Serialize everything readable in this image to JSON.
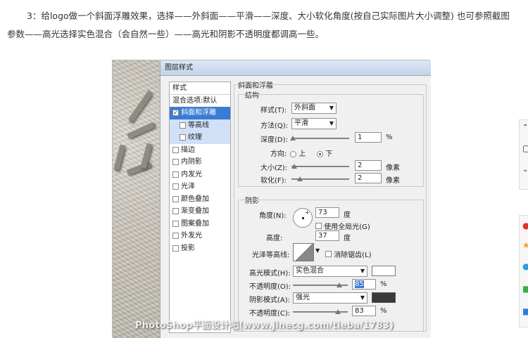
{
  "article": {
    "paragraph": "3：给logo做一个斜面浮雕效果，选择——外斜面——平滑——深度、大小软化角度(按自己实际图片大小调整) 也可参照截图参数——高光选择实色混合（会自然一些）——高光和阴影不透明度都调高一些。"
  },
  "dialog": {
    "title": "图层样式",
    "style_list": {
      "header": "样式",
      "blend": "混合选项:默认",
      "items": [
        {
          "label": "斜面和浮雕",
          "checked": true,
          "selected": true
        },
        {
          "label": "等高线",
          "checked": false,
          "sub": true
        },
        {
          "label": "纹理",
          "checked": false,
          "sub": true
        },
        {
          "label": "描边",
          "checked": false
        },
        {
          "label": "内阴影",
          "checked": false
        },
        {
          "label": "内发光",
          "checked": false
        },
        {
          "label": "光泽",
          "checked": false
        },
        {
          "label": "颜色叠加",
          "checked": false
        },
        {
          "label": "渐变叠加",
          "checked": false
        },
        {
          "label": "图案叠加",
          "checked": false
        },
        {
          "label": "外发光",
          "checked": false
        },
        {
          "label": "投影",
          "checked": false
        }
      ]
    },
    "bevel": {
      "group_title": "斜面和浮雕",
      "structure_title": "结构",
      "style_label": "样式(T):",
      "style_value": "外斜面",
      "technique_label": "方法(Q):",
      "technique_value": "平滑",
      "depth_label": "深度(D):",
      "depth_value": "1",
      "depth_unit": "%",
      "direction_label": "方向:",
      "dir_up": "上",
      "dir_down": "下",
      "direction_selected": "下",
      "size_label": "大小(Z):",
      "size_value": "2",
      "size_unit": "像素",
      "soften_label": "软化(F):",
      "soften_value": "2",
      "soften_unit": "像素"
    },
    "shading": {
      "title": "阴影",
      "angle_label": "角度(N):",
      "angle_value": "73",
      "angle_unit": "度",
      "global_light": "使用全局光(G)",
      "altitude_label": "高度:",
      "altitude_value": "37",
      "altitude_unit": "度",
      "gloss_label": "光泽等高线:",
      "antialias": "消除锯齿(L)",
      "highlight_mode_label": "高光模式(H):",
      "highlight_mode": "实色混合",
      "highlight_color": "#ffffff",
      "highlight_opacity_label": "不透明度(O):",
      "highlight_opacity": "85",
      "highlight_opacity_unit": "%",
      "shadow_mode_label": "阴影模式(A):",
      "shadow_mode": "强光",
      "shadow_color": "#3a3a3a",
      "shadow_opacity_label": "不透明度(C):",
      "shadow_opacity": "83",
      "shadow_opacity_unit": "%"
    }
  },
  "watermark": "PhotoShop平面设计吧(www.jinecg.com/tieba/1783)",
  "sidebar_icons": [
    "chevron-up-icon",
    "edit-icon",
    "chevron-down-icon",
    "red-dot-icon",
    "star-icon",
    "share-icon",
    "wechat-icon",
    "blue-icon"
  ]
}
